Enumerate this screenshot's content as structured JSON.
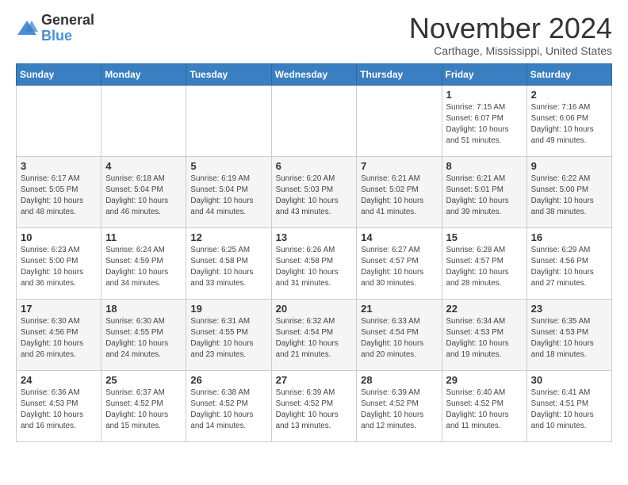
{
  "logo": {
    "general": "General",
    "blue": "Blue"
  },
  "header": {
    "month_title": "November 2024",
    "location": "Carthage, Mississippi, United States"
  },
  "days_of_week": [
    "Sunday",
    "Monday",
    "Tuesday",
    "Wednesday",
    "Thursday",
    "Friday",
    "Saturday"
  ],
  "weeks": [
    [
      {
        "day": "",
        "info": ""
      },
      {
        "day": "",
        "info": ""
      },
      {
        "day": "",
        "info": ""
      },
      {
        "day": "",
        "info": ""
      },
      {
        "day": "",
        "info": ""
      },
      {
        "day": "1",
        "info": "Sunrise: 7:15 AM\nSunset: 6:07 PM\nDaylight: 10 hours\nand 51 minutes."
      },
      {
        "day": "2",
        "info": "Sunrise: 7:16 AM\nSunset: 6:06 PM\nDaylight: 10 hours\nand 49 minutes."
      }
    ],
    [
      {
        "day": "3",
        "info": "Sunrise: 6:17 AM\nSunset: 5:05 PM\nDaylight: 10 hours\nand 48 minutes."
      },
      {
        "day": "4",
        "info": "Sunrise: 6:18 AM\nSunset: 5:04 PM\nDaylight: 10 hours\nand 46 minutes."
      },
      {
        "day": "5",
        "info": "Sunrise: 6:19 AM\nSunset: 5:04 PM\nDaylight: 10 hours\nand 44 minutes."
      },
      {
        "day": "6",
        "info": "Sunrise: 6:20 AM\nSunset: 5:03 PM\nDaylight: 10 hours\nand 43 minutes."
      },
      {
        "day": "7",
        "info": "Sunrise: 6:21 AM\nSunset: 5:02 PM\nDaylight: 10 hours\nand 41 minutes."
      },
      {
        "day": "8",
        "info": "Sunrise: 6:21 AM\nSunset: 5:01 PM\nDaylight: 10 hours\nand 39 minutes."
      },
      {
        "day": "9",
        "info": "Sunrise: 6:22 AM\nSunset: 5:00 PM\nDaylight: 10 hours\nand 38 minutes."
      }
    ],
    [
      {
        "day": "10",
        "info": "Sunrise: 6:23 AM\nSunset: 5:00 PM\nDaylight: 10 hours\nand 36 minutes."
      },
      {
        "day": "11",
        "info": "Sunrise: 6:24 AM\nSunset: 4:59 PM\nDaylight: 10 hours\nand 34 minutes."
      },
      {
        "day": "12",
        "info": "Sunrise: 6:25 AM\nSunset: 4:58 PM\nDaylight: 10 hours\nand 33 minutes."
      },
      {
        "day": "13",
        "info": "Sunrise: 6:26 AM\nSunset: 4:58 PM\nDaylight: 10 hours\nand 31 minutes."
      },
      {
        "day": "14",
        "info": "Sunrise: 6:27 AM\nSunset: 4:57 PM\nDaylight: 10 hours\nand 30 minutes."
      },
      {
        "day": "15",
        "info": "Sunrise: 6:28 AM\nSunset: 4:57 PM\nDaylight: 10 hours\nand 28 minutes."
      },
      {
        "day": "16",
        "info": "Sunrise: 6:29 AM\nSunset: 4:56 PM\nDaylight: 10 hours\nand 27 minutes."
      }
    ],
    [
      {
        "day": "17",
        "info": "Sunrise: 6:30 AM\nSunset: 4:56 PM\nDaylight: 10 hours\nand 26 minutes."
      },
      {
        "day": "18",
        "info": "Sunrise: 6:30 AM\nSunset: 4:55 PM\nDaylight: 10 hours\nand 24 minutes."
      },
      {
        "day": "19",
        "info": "Sunrise: 6:31 AM\nSunset: 4:55 PM\nDaylight: 10 hours\nand 23 minutes."
      },
      {
        "day": "20",
        "info": "Sunrise: 6:32 AM\nSunset: 4:54 PM\nDaylight: 10 hours\nand 21 minutes."
      },
      {
        "day": "21",
        "info": "Sunrise: 6:33 AM\nSunset: 4:54 PM\nDaylight: 10 hours\nand 20 minutes."
      },
      {
        "day": "22",
        "info": "Sunrise: 6:34 AM\nSunset: 4:53 PM\nDaylight: 10 hours\nand 19 minutes."
      },
      {
        "day": "23",
        "info": "Sunrise: 6:35 AM\nSunset: 4:53 PM\nDaylight: 10 hours\nand 18 minutes."
      }
    ],
    [
      {
        "day": "24",
        "info": "Sunrise: 6:36 AM\nSunset: 4:53 PM\nDaylight: 10 hours\nand 16 minutes."
      },
      {
        "day": "25",
        "info": "Sunrise: 6:37 AM\nSunset: 4:52 PM\nDaylight: 10 hours\nand 15 minutes."
      },
      {
        "day": "26",
        "info": "Sunrise: 6:38 AM\nSunset: 4:52 PM\nDaylight: 10 hours\nand 14 minutes."
      },
      {
        "day": "27",
        "info": "Sunrise: 6:39 AM\nSunset: 4:52 PM\nDaylight: 10 hours\nand 13 minutes."
      },
      {
        "day": "28",
        "info": "Sunrise: 6:39 AM\nSunset: 4:52 PM\nDaylight: 10 hours\nand 12 minutes."
      },
      {
        "day": "29",
        "info": "Sunrise: 6:40 AM\nSunset: 4:52 PM\nDaylight: 10 hours\nand 11 minutes."
      },
      {
        "day": "30",
        "info": "Sunrise: 6:41 AM\nSunset: 4:51 PM\nDaylight: 10 hours\nand 10 minutes."
      }
    ]
  ]
}
